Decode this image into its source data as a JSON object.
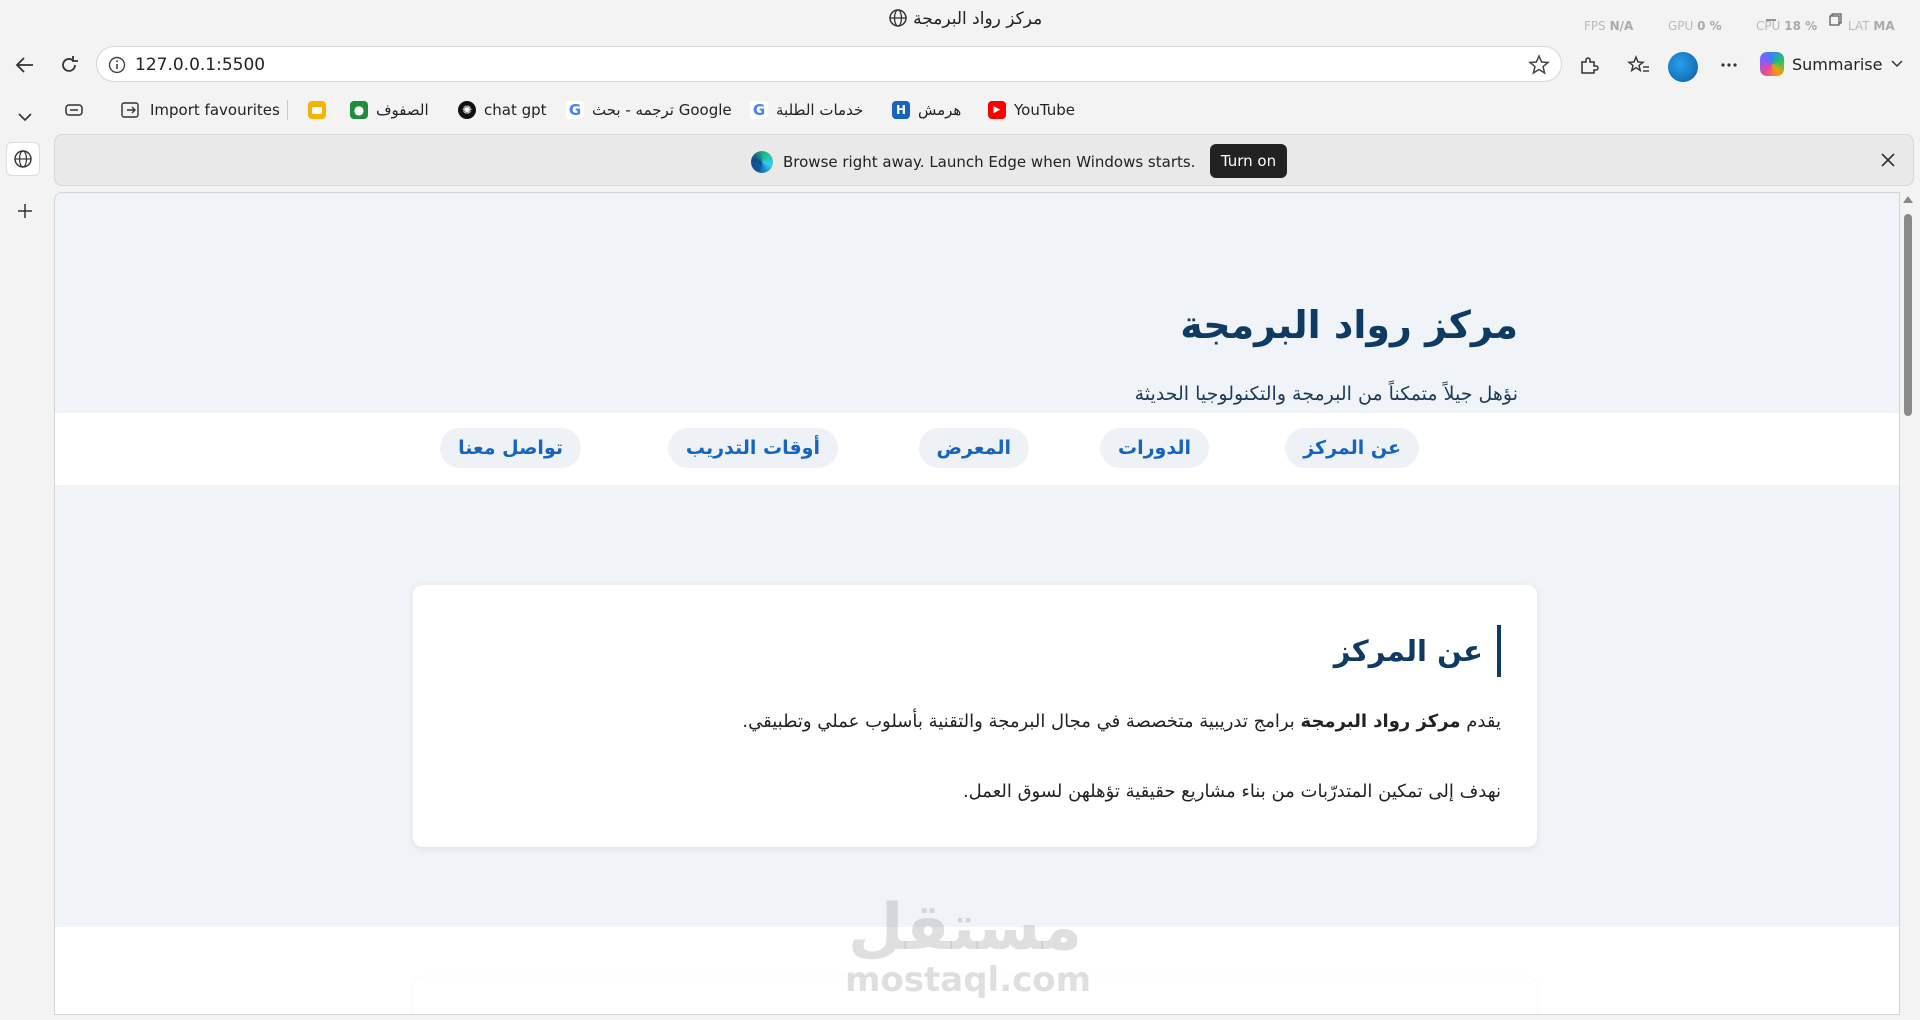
{
  "window": {
    "title": "مركز رواد البرمجة",
    "perf": {
      "fps_label": "FPS",
      "fps_value": "N/A",
      "gpu_label": "GPU",
      "gpu_value": "0 %",
      "cpu_label": "CPU",
      "cpu_value": "18 %",
      "lat_label": "LAT",
      "lat_value": "MA"
    }
  },
  "address_bar": {
    "url": "127.0.0.1:5500"
  },
  "toolbar": {
    "summarise_label": "Summarise"
  },
  "bookmarks": {
    "import_label": "Import favourites",
    "items": [
      {
        "label": "الصفوف",
        "icon": "classroom-icon"
      },
      {
        "label": "chat gpt",
        "icon": "chatgpt-icon"
      },
      {
        "label": "ترجمه - بحث Google",
        "icon": "google-icon"
      },
      {
        "label": "خدمات الطلبة",
        "icon": "google-icon"
      },
      {
        "label": "هرمش",
        "icon": "harmash-icon"
      },
      {
        "label": "YouTube",
        "icon": "youtube-icon"
      }
    ]
  },
  "infobar": {
    "message": "Browse right away. Launch Edge when Windows starts.",
    "button_label": "Turn on"
  },
  "page": {
    "title": "مركز رواد البرمجة",
    "subtitle": "نؤهل جيلاً متمكناً من البرمجة والتكنولوجيا الحديثة",
    "nav": [
      "عن المركز",
      "الدورات",
      "المعرض",
      "أوقات التدريب",
      "تواصل معنا"
    ],
    "about": {
      "heading": "عن المركز",
      "p1_before": "يقدم",
      "p1_bold": "مركز رواد البرمجة",
      "p1_after": "برامج تدريبية متخصصة في مجال البرمجة والتقنية بأسلوب عملي وتطبيقي.",
      "p2": "نهدف إلى تمكين المتدرّبات من بناء مشاريع حقيقية تؤهلهن لسوق العمل."
    },
    "watermark": {
      "arabic": "مستقل",
      "latin": "mostaql.com"
    }
  },
  "colors": {
    "primary": "#0f3b63",
    "link": "#1565c0",
    "page_bg": "#f0f4f8"
  }
}
